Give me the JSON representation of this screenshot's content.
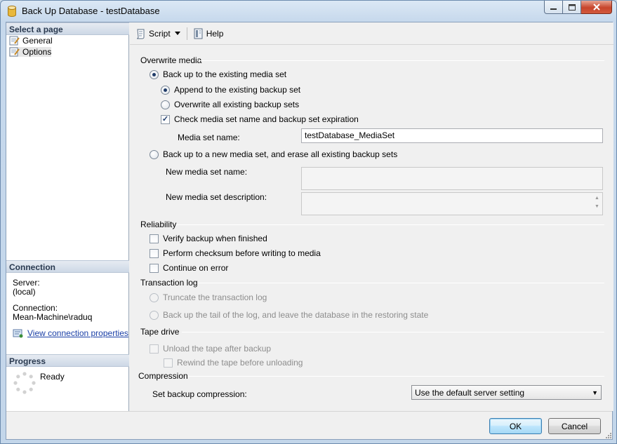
{
  "window": {
    "title": "Back Up Database - testDatabase"
  },
  "left": {
    "select_page_header": "Select a page",
    "pages": [
      {
        "label": "General"
      },
      {
        "label": "Options"
      }
    ],
    "connection_header": "Connection",
    "server_label": "Server:",
    "server_value": "(local)",
    "connection_label": "Connection:",
    "connection_value": "Mean-Machine\\raduq",
    "view_props_link": "View connection properties",
    "progress_header": "Progress",
    "progress_status": "Ready"
  },
  "toolbar": {
    "script_label": "Script",
    "help_label": "Help"
  },
  "overwrite": {
    "group_label": "Overwrite media",
    "existing_set": "Back up to the existing media set",
    "append": "Append to the existing backup set",
    "overwrite_all": "Overwrite all existing backup sets",
    "check_name": "Check media set name and backup set expiration",
    "media_set_name_label": "Media set name:",
    "media_set_name_value": "testDatabase_MediaSet",
    "new_set": "Back up to a new media set, and erase all existing backup sets",
    "new_media_name_label": "New media set name:",
    "new_media_desc_label": "New media set description:"
  },
  "reliability": {
    "group_label": "Reliability",
    "verify": "Verify backup when finished",
    "checksum": "Perform checksum before writing to media",
    "continue_on_error": "Continue on error"
  },
  "transaction_log": {
    "group_label": "Transaction log",
    "truncate": "Truncate the transaction log",
    "tail": "Back up the tail of the log, and leave the database in the restoring state"
  },
  "tape": {
    "group_label": "Tape drive",
    "unload": "Unload the tape after backup",
    "rewind": "Rewind the tape before unloading"
  },
  "compression": {
    "group_label": "Compression",
    "label": "Set backup compression:",
    "selected": "Use the default server setting"
  },
  "buttons": {
    "ok": "OK",
    "cancel": "Cancel"
  }
}
